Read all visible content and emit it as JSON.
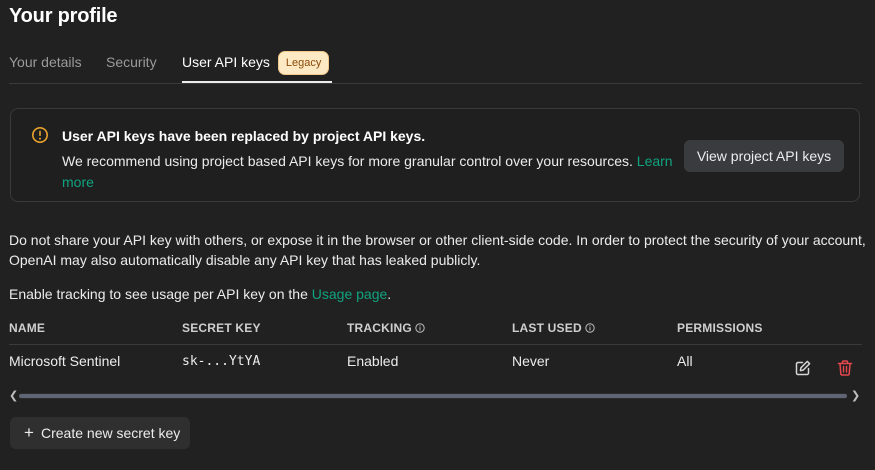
{
  "page": {
    "title": "Your profile"
  },
  "tabs": [
    {
      "label": "Your details"
    },
    {
      "label": "Security"
    },
    {
      "label": "User API keys",
      "badge": "Legacy"
    }
  ],
  "callout": {
    "icon": "warning-circle-icon",
    "title": "User API keys have been replaced by project API keys.",
    "body": "We recommend using project based API keys for more granular control over your resources.",
    "link_text": "Learn more",
    "button_label": "View project API keys"
  },
  "notice": {
    "text": "Do not share your API key with others, or expose it in the browser or other client-side code. In order to protect the security of your account, OpenAI may also automatically disable any API key that has leaked publicly.",
    "tracking_prefix": "Enable tracking to see usage per API key on the",
    "tracking_link": "Usage page",
    "tracking_suffix": "."
  },
  "table": {
    "columns": [
      "NAME",
      "SECRET KEY",
      "TRACKING",
      "LAST USED",
      "PERMISSIONS"
    ],
    "rows": [
      {
        "name": "Microsoft Sentinel",
        "secret_key": "sk-...YtYA",
        "tracking": "Enabled",
        "last_used": "Never",
        "permissions": "All"
      }
    ]
  },
  "actions": {
    "create_label": "Create new secret key"
  },
  "colors": {
    "background": "#212121",
    "accent_green": "#10a37f",
    "warning": "#e8a32c",
    "danger": "#e5484d",
    "badge_bg": "#fde9c4"
  }
}
